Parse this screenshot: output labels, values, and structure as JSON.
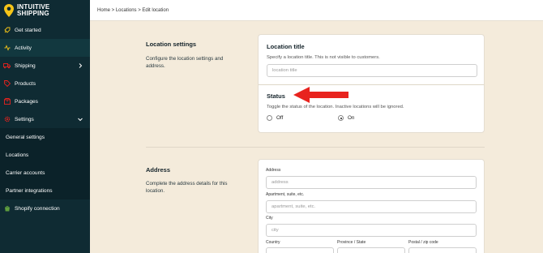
{
  "brand": {
    "line1": "INTUITIVE",
    "line2": "SHIPPING",
    "accent": "#f5c518"
  },
  "sidebar": {
    "items": [
      {
        "label": "Get started",
        "icon": "rocket-icon"
      },
      {
        "label": "Activity",
        "icon": "activity-icon"
      },
      {
        "label": "Shipping",
        "icon": "truck-icon"
      },
      {
        "label": "Products",
        "icon": "tag-icon"
      },
      {
        "label": "Packages",
        "icon": "box-icon"
      },
      {
        "label": "Settings",
        "icon": "gear-icon"
      }
    ],
    "subitems": [
      {
        "label": "General settings"
      },
      {
        "label": "Locations"
      },
      {
        "label": "Carrier accounts"
      },
      {
        "label": "Partner integrations"
      }
    ],
    "shopify": {
      "label": "Shopify connection",
      "icon": "shopify-icon"
    }
  },
  "breadcrumb": "Home > Locations > Edit location",
  "location_settings": {
    "title": "Location settings",
    "description_line1": "Configure the location settings and",
    "description_line2": "address."
  },
  "location_title_card": {
    "title": "Location title",
    "help": "Specify a location title. This is not visible to customers.",
    "placeholder": "location title"
  },
  "status_card": {
    "title": "Status",
    "help": "Toggle the status of the location. Inactive locations will be ignored.",
    "off_label": "Off",
    "on_label": "On",
    "selected": "On"
  },
  "address_section": {
    "title": "Address",
    "description_line1": "Complete the address details for this",
    "description_line2": "location."
  },
  "address_card": {
    "address_label": "Address",
    "address_placeholder": "address",
    "apt_label": "Apartment, suite, etc.",
    "apt_placeholder": "apartment, suite, etc.",
    "city_label": "City",
    "city_placeholder": "city",
    "country_label": "Country",
    "province_label": "Province / State",
    "postal_label": "Postal / zip code"
  },
  "colors": {
    "sidebar": "#0f2b33",
    "background": "#f4ebdb",
    "arrow": "#e8231e"
  }
}
